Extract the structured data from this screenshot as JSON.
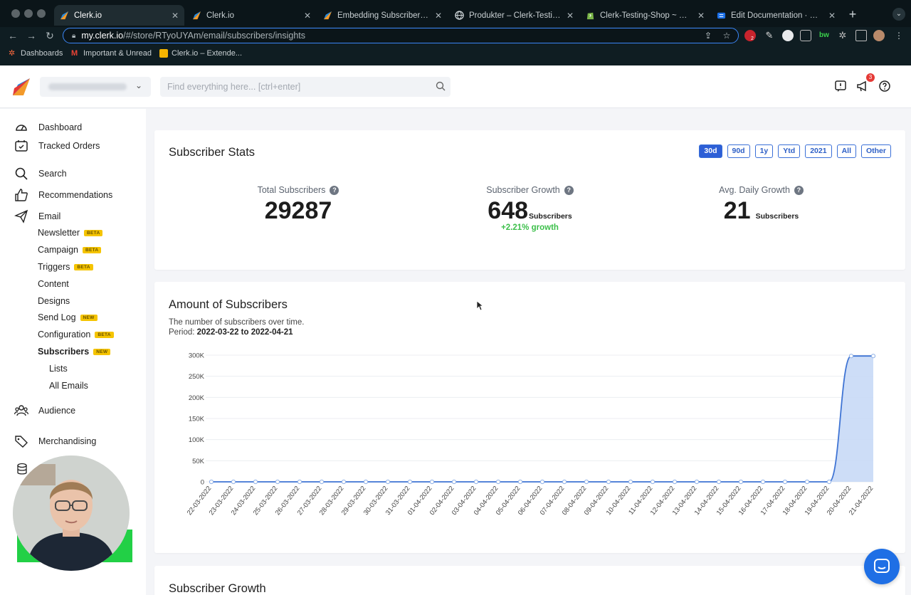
{
  "browser": {
    "tabs": [
      {
        "label": "Clerk.io",
        "active": true
      },
      {
        "label": "Clerk.io",
        "active": false
      },
      {
        "label": "Embedding Subscriber Form",
        "active": false
      },
      {
        "label": "Produkter – Clerk-Testing-S",
        "active": false
      },
      {
        "label": "Clerk-Testing-Shop ~ Edit",
        "active": false
      },
      {
        "label": "Edit Documentation · Readme",
        "active": false
      }
    ],
    "url_host": "my.clerk.io",
    "url_path": "/#/store/RTyoUYAm/email/subscribers/insights",
    "extension_badge": "2",
    "bookmarks": [
      "Dashboards",
      "Important & Unread",
      "Clerk.io – Extende..."
    ]
  },
  "header": {
    "search_placeholder": "Find everything here... [ctrl+enter]",
    "notifications_count": "3"
  },
  "sidebar": {
    "items": [
      {
        "label": "Dashboard",
        "icon": "dashboard-icon"
      },
      {
        "label": "Tracked Orders",
        "icon": "tracked-orders-icon"
      },
      {
        "label": "Search",
        "icon": "search-icon"
      },
      {
        "label": "Recommendations",
        "icon": "thumbs-up-icon"
      },
      {
        "label": "Email",
        "icon": "paper-plane-icon"
      }
    ],
    "email_sub": [
      {
        "label": "Newsletter",
        "badge": "BETA"
      },
      {
        "label": "Campaign",
        "badge": "BETA"
      },
      {
        "label": "Triggers",
        "badge": "BETA"
      },
      {
        "label": "Content",
        "badge": ""
      },
      {
        "label": "Designs",
        "badge": ""
      },
      {
        "label": "Send Log",
        "badge": "NEW"
      },
      {
        "label": "Configuration",
        "badge": "BETA"
      },
      {
        "label": "Subscribers",
        "badge": "NEW"
      }
    ],
    "subscribers_sub": [
      "Lists",
      "All Emails"
    ],
    "lower_items": [
      {
        "label": "Audience",
        "icon": "audience-icon"
      },
      {
        "label": "Merchandising",
        "icon": "tags-icon"
      }
    ]
  },
  "stats": {
    "title": "Subscriber Stats",
    "ranges": [
      "30d",
      "90d",
      "1y",
      "Ytd",
      "2021",
      "All",
      "Other"
    ],
    "active_range": "30d",
    "total_label": "Total Subscribers",
    "total_value": "29287",
    "growth_label": "Subscriber Growth",
    "growth_value": "648",
    "growth_unit": "Subscribers",
    "growth_pct": "+2.21% growth",
    "avg_label": "Avg. Daily Growth",
    "avg_value": "21",
    "avg_unit": "Subscribers"
  },
  "amount_card": {
    "title": "Amount of Subscribers",
    "description": "The number of subscribers over time.",
    "period_label": "Period:",
    "period_value": "2022-03-22 to 2022-04-21"
  },
  "growth_card": {
    "title": "Subscriber Growth"
  },
  "colors": {
    "accent": "#2d5fd6",
    "line": "#3f74d4",
    "area": "#c8d9f6",
    "growth": "#3cbf4a"
  },
  "chart_data": {
    "type": "area",
    "x": [
      "22-03-2022",
      "23-03-2022",
      "24-03-2022",
      "25-03-2022",
      "26-03-2022",
      "27-03-2022",
      "28-03-2022",
      "29-03-2022",
      "30-03-2022",
      "31-03-2022",
      "01-04-2022",
      "02-04-2022",
      "03-04-2022",
      "04-04-2022",
      "05-04-2022",
      "06-04-2022",
      "07-04-2022",
      "08-04-2022",
      "09-04-2022",
      "10-04-2022",
      "11-04-2022",
      "12-04-2022",
      "13-04-2022",
      "14-04-2022",
      "15-04-2022",
      "16-04-2022",
      "17-04-2022",
      "18-04-2022",
      "19-04-2022",
      "20-04-2022",
      "21-04-2022"
    ],
    "values": [
      0,
      0,
      0,
      0,
      0,
      0,
      0,
      0,
      0,
      0,
      0,
      0,
      0,
      0,
      0,
      0,
      0,
      0,
      0,
      0,
      0,
      0,
      0,
      0,
      0,
      0,
      0,
      0,
      0,
      298000,
      298000
    ],
    "yticks": [
      0,
      50000,
      100000,
      150000,
      200000,
      250000,
      300000
    ],
    "ytick_labels": [
      "0",
      "50K",
      "100K",
      "150K",
      "200K",
      "250K",
      "300K"
    ],
    "ylim": [
      0,
      300000
    ],
    "grid": true
  }
}
